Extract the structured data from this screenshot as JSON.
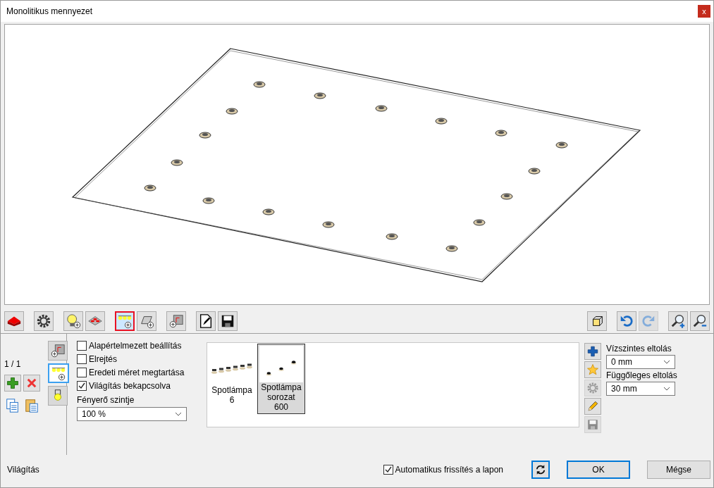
{
  "window": {
    "title": "Monolitikus mennyezet",
    "close": "x"
  },
  "toolbar": {
    "left": [
      {
        "kind": "floor",
        "selected": false
      },
      {
        "kind": "gear",
        "selected": false
      },
      {
        "kind": "bulb",
        "selected": false
      },
      {
        "kind": "ceiling",
        "selected": false
      },
      {
        "kind": "spots",
        "selected": true
      },
      {
        "kind": "panel",
        "selected": false
      },
      {
        "kind": "corner",
        "selected": false
      },
      {
        "kind": "edit",
        "selected": false
      },
      {
        "kind": "save",
        "selected": false
      }
    ],
    "right": [
      {
        "kind": "cube",
        "disabled": false
      },
      {
        "kind": "undo",
        "disabled": false
      },
      {
        "kind": "redo",
        "disabled": true
      },
      {
        "kind": "zoom-in",
        "disabled": false
      },
      {
        "kind": "zoom-out",
        "disabled": false
      }
    ]
  },
  "side_tabs": [
    {
      "kind": "corner",
      "selected": false
    },
    {
      "kind": "spots",
      "selected": true
    },
    {
      "kind": "lamp",
      "selected": false
    }
  ],
  "counter": "1 / 1",
  "options": [
    {
      "label": "Alapértelmezett beállítás",
      "checked": false
    },
    {
      "label": "Elrejtés",
      "checked": false
    },
    {
      "label": "Eredeti méret megtartása",
      "checked": false
    },
    {
      "label": "Világítás bekapcsolva",
      "checked": true
    }
  ],
  "brightness": {
    "label": "Fényerő szintje",
    "value": "100 %"
  },
  "library": [
    {
      "kind": "row",
      "name": "Spotlámpa 6",
      "selected": false
    },
    {
      "kind": "scatter",
      "name": "Spotlámpa sorozat 600",
      "selected": true
    }
  ],
  "library_tools": [
    {
      "kind": "add",
      "disabled": false
    },
    {
      "kind": "star",
      "disabled": false
    },
    {
      "kind": "gear",
      "disabled": true
    },
    {
      "kind": "pencil",
      "disabled": false
    },
    {
      "kind": "save",
      "disabled": true
    }
  ],
  "offsets": [
    {
      "label": "Vízszintes eltolás",
      "value": "0 mm"
    },
    {
      "label": "Függőleges eltolás",
      "value": "30 mm"
    }
  ],
  "status": {
    "label": "Világítás",
    "auto_refresh": {
      "label": "Automatikus frissítés a lapon",
      "checked": true
    },
    "ok": "OK",
    "cancel": "Mégse"
  }
}
